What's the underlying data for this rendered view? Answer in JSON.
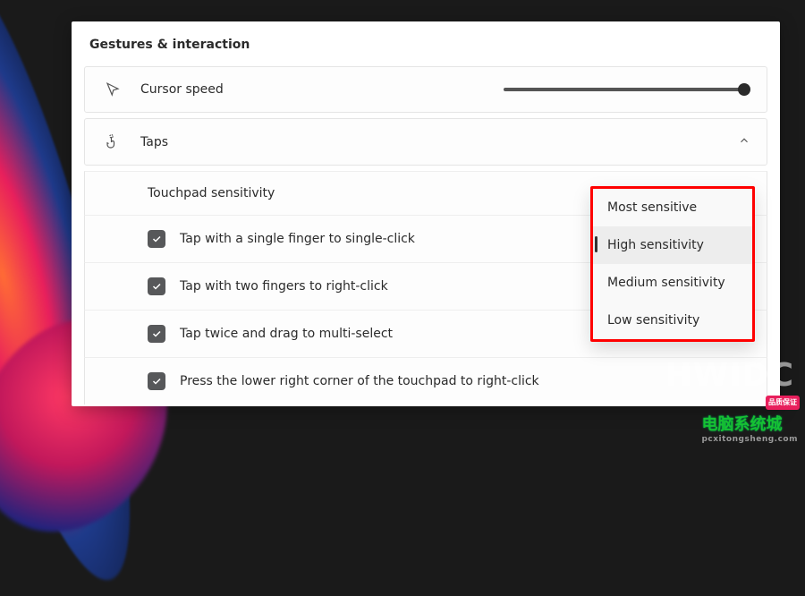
{
  "section": {
    "title": "Gestures & interaction"
  },
  "cursorSpeed": {
    "label": "Cursor speed",
    "value": 100
  },
  "taps": {
    "label": "Taps",
    "sensitivityLabel": "Touchpad sensitivity",
    "options": [
      {
        "label": "Tap with a single finger to single-click",
        "checked": true
      },
      {
        "label": "Tap with two fingers to right-click",
        "checked": true
      },
      {
        "label": "Tap twice and drag to multi-select",
        "checked": true
      },
      {
        "label": "Press the lower right corner of the touchpad to right-click",
        "checked": true
      }
    ]
  },
  "sensitivityDropdown": {
    "items": [
      "Most sensitive",
      "High sensitivity",
      "Medium sensitivity",
      "Low sensitivity"
    ],
    "selectedIndex": 1
  },
  "watermark": "HWIDC",
  "cornerBadge": {
    "ribbon": "品质保证",
    "main": "电脑系统城",
    "sub": "pcxitongsheng.com"
  }
}
